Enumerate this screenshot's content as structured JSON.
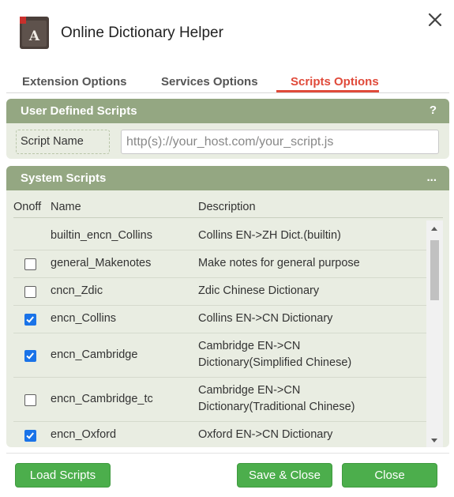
{
  "app": {
    "title": "Online Dictionary Helper",
    "icon": "dictionary-book-icon",
    "close_icon": "close-icon"
  },
  "tabs": [
    {
      "label": "Extension Options",
      "active": false
    },
    {
      "label": "Services Options",
      "active": false
    },
    {
      "label": "Scripts Options",
      "active": true
    }
  ],
  "user_defined": {
    "title": "User Defined Scripts",
    "help": "?",
    "label": "Script Name",
    "placeholder": "http(s)://your_host.com/your_script.js",
    "value": ""
  },
  "system_scripts": {
    "title": "System Scripts",
    "menu": "...",
    "columns": {
      "onoff": "Onoff",
      "name": "Name",
      "description": "Description"
    },
    "rows": [
      {
        "checkbox": "none",
        "name": "builtin_encn_Collins",
        "desc1": "Collins EN->ZH Dict.(builtin)",
        "desc2": ""
      },
      {
        "checkbox": "off",
        "name": "general_Makenotes",
        "desc1": "Make notes for general purpose",
        "desc2": ""
      },
      {
        "checkbox": "off",
        "name": "cncn_Zdic",
        "desc1": "Zdic Chinese Dictionary",
        "desc2": ""
      },
      {
        "checkbox": "on",
        "name": "encn_Collins",
        "desc1": "Collins EN->CN Dictionary",
        "desc2": ""
      },
      {
        "checkbox": "on",
        "name": "encn_Cambridge",
        "desc1": "Cambridge EN->CN",
        "desc2": "Dictionary(Simplified Chinese)"
      },
      {
        "checkbox": "off",
        "name": "encn_Cambridge_tc",
        "desc1": "Cambridge EN->CN",
        "desc2": "Dictionary(Traditional Chinese)"
      },
      {
        "checkbox": "on",
        "name": "encn_Oxford",
        "desc1": "Oxford EN->CN Dictionary",
        "desc2": ""
      }
    ]
  },
  "buttons": {
    "load": "Load Scripts",
    "save_close": "Save & Close",
    "close": "Close"
  },
  "colors": {
    "accent": "#e04a3a",
    "panel_header": "#94a782",
    "panel_body": "#e9ede2",
    "button": "#4cae4c",
    "checkbox": "#1a73e8"
  }
}
